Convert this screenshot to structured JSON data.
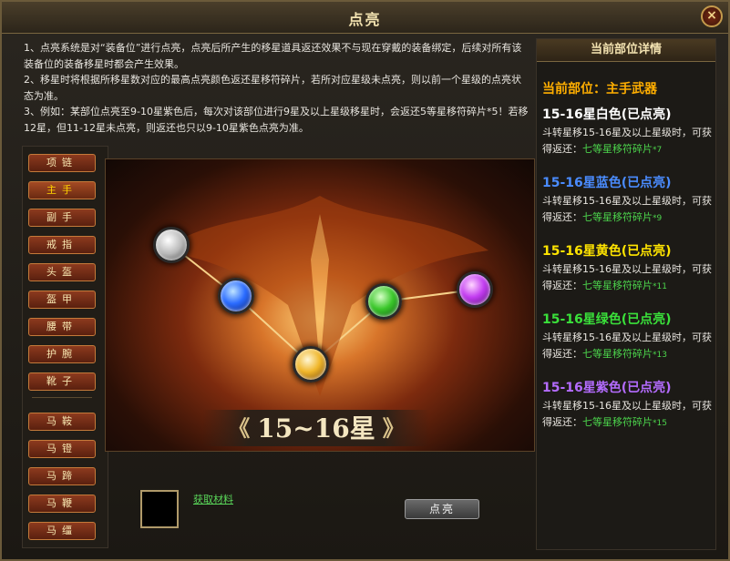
{
  "window": {
    "title": "点亮",
    "close_symbol": "×"
  },
  "intro": {
    "line1": "1、点亮系统是对“装备位”进行点亮，点亮后所产生的移星道具返还效果不与现在穿戴的装备绑定，后续对所有该装备位的装备移星时都会产生效果。",
    "line2": "2、移星时将根据所移星数对应的最高点亮颜色返还星移符碎片，若所对应星级未点亮，则以前一个星级的点亮状态为准。",
    "line3": "3、例如：某部位点亮至9-10星紫色后，每次对该部位进行9星及以上星级移星时，会返还5等星移符碎片*5！若移12星，但11-12星未点亮，则返还也只以9-10星紫色点亮为准。"
  },
  "slots": [
    {
      "label": "项链",
      "active": false
    },
    {
      "label": "主手",
      "active": true
    },
    {
      "label": "副手",
      "active": false
    },
    {
      "label": "戒指",
      "active": false
    },
    {
      "label": "头盔",
      "active": false
    },
    {
      "label": "盔甲",
      "active": false
    },
    {
      "label": "腰带",
      "active": false
    },
    {
      "label": "护腕",
      "active": false
    },
    {
      "label": "靴子",
      "active": false
    },
    {
      "label": "马鞍",
      "active": false
    },
    {
      "label": "马镫",
      "active": false
    },
    {
      "label": "马蹄",
      "active": false
    },
    {
      "label": "马鞭",
      "active": false
    },
    {
      "label": "马缰",
      "active": false
    }
  ],
  "stage": {
    "banner_left": "《",
    "banner_text": "15~16星",
    "banner_right": "》",
    "gems": [
      "white",
      "blue",
      "green",
      "purple",
      "yellow"
    ]
  },
  "material": {
    "link_label": "获取材料"
  },
  "action": {
    "light_label": "点亮"
  },
  "detail": {
    "header": "当前部位详情",
    "current_label": "当前部位：主手武器",
    "tiers": [
      {
        "title": "15-16星白色(已点亮)",
        "color": "#ffffff",
        "desc": "斗转星移15-16星及以上星级时，可获得返还：",
        "reward": "七等星移符碎片",
        "count": "*7"
      },
      {
        "title": "15-16星蓝色(已点亮)",
        "color": "#4a8cff",
        "desc": "斗转星移15-16星及以上星级时，可获得返还：",
        "reward": "七等星移符碎片",
        "count": "*9"
      },
      {
        "title": "15-16星黄色(已点亮)",
        "color": "#ffe400",
        "desc": "斗转星移15-16星及以上星级时，可获得返还：",
        "reward": "七等星移符碎片",
        "count": "*11"
      },
      {
        "title": "15-16星绿色(已点亮)",
        "color": "#3ae03a",
        "desc": "斗转星移15-16星及以上星级时，可获得返还：",
        "reward": "七等星移符碎片",
        "count": "*13"
      },
      {
        "title": "15-16星紫色(已点亮)",
        "color": "#b46cff",
        "desc": "斗转星移15-16星及以上星级时，可获得返还：",
        "reward": "七等星移符碎片",
        "count": "*15"
      }
    ]
  }
}
